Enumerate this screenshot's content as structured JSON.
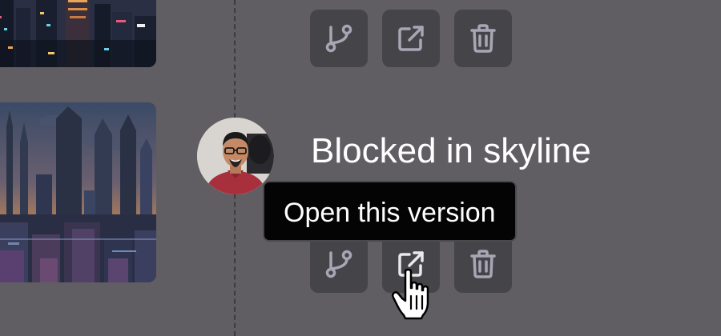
{
  "version_entry": {
    "title": "Blocked in skyline"
  },
  "tooltip": {
    "text": "Open this version"
  },
  "actions": {
    "branch_icon": "git-branch-icon",
    "open_icon": "external-link-icon",
    "delete_icon": "trash-icon"
  },
  "colors": {
    "background": "#605e62",
    "button_background": "#454449",
    "icon_color": "#a8a6b4",
    "tooltip_background": "#040404",
    "title_color": "#ffffff"
  }
}
